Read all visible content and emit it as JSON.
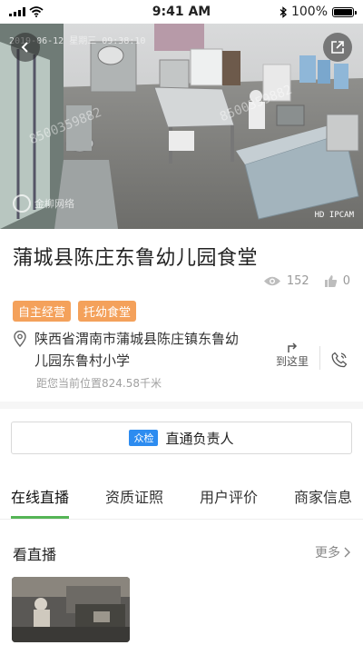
{
  "status_bar": {
    "time": "9:41 AM",
    "battery": "100%",
    "battery_level": 1.0
  },
  "camera": {
    "timestamp": "2019-06-12 星期三 09:38:10",
    "device_tag": "HD IPCAM",
    "watermark_number": "8500359882",
    "watermark_brand": "金柳网络"
  },
  "store": {
    "name": "蒲城县陈庄东鲁幼儿园食堂",
    "views": "152",
    "likes": "0",
    "tags": [
      "自主经营",
      "托幼食堂"
    ],
    "address": "陕西省渭南市蒲城县陈庄镇东鲁幼儿园东鲁村小学",
    "goto_label": "到这里",
    "distance": "距您当前位置824.58千米"
  },
  "contact": {
    "badge": "众检",
    "label": "直通负责人"
  },
  "tabs": [
    "在线直播",
    "资质证照",
    "用户评价",
    "商家信息"
  ],
  "live_section": {
    "title": "看直播",
    "more_label": "更多"
  },
  "colors": {
    "accent_green": "#55b556",
    "tag_orange": "#f4a15b",
    "badge_blue": "#2d8cf0"
  }
}
